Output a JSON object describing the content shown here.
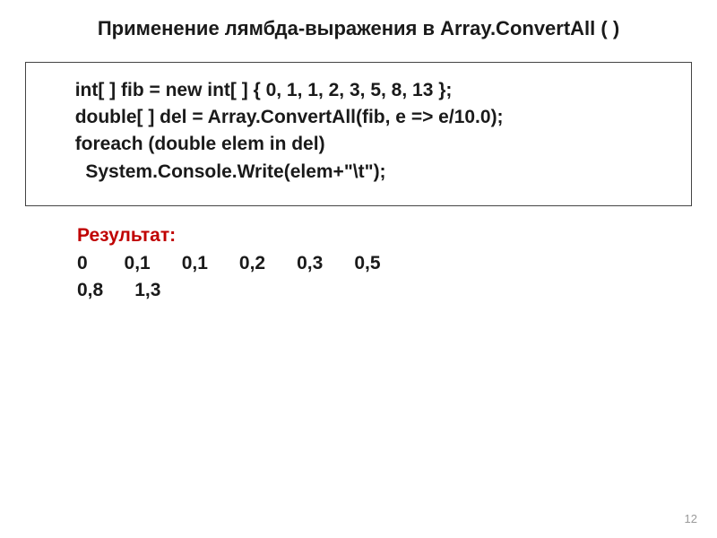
{
  "title": "Применение лямбда-выражения в Array.ConvertAll ( )",
  "code": {
    "line1": "        int[ ] fib = new int[ ] { 0, 1, 1, 2, 3, 5, 8, 13 };",
    "line2": "        double[ ] del = Array.ConvertAll(fib, e => e/10.0);",
    "line3": "        foreach (double elem in del)",
    "line4": "          System.Console.Write(elem+\"\\t\");"
  },
  "result": {
    "label": "Результат:",
    "values_line1": "0       0,1      0,1      0,2      0,3      0,5",
    "values_line2": "0,8      1,3"
  },
  "page_number": "12"
}
